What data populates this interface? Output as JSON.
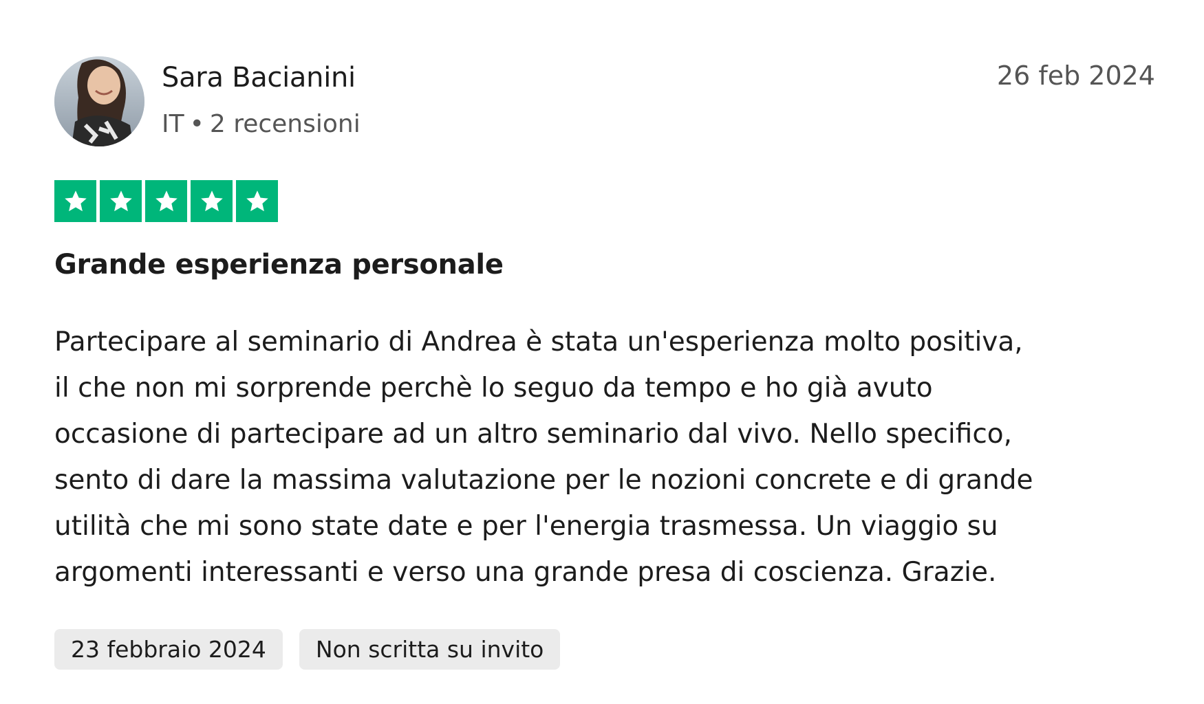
{
  "review": {
    "author": {
      "name": "Sara Bacianini",
      "country": "IT",
      "separator": "•",
      "review_count": "2 recensioni",
      "avatar": "user-photo"
    },
    "date": "26 feb 2024",
    "rating": {
      "value": 5,
      "max": 5,
      "color": "#00b67a",
      "icon": "star-icon"
    },
    "title": "Grande esperienza personale",
    "body_lines": [
      "Partecipare al seminario di Andrea è stata un'esperienza molto positiva,",
      "il che non mi sorprende perchè lo seguo da tempo e ho già avuto",
      "occasione di partecipare ad un altro seminario dal vivo. Nello specifico,",
      "sento di dare la massima valutazione per le nozioni concrete e di grande",
      "utilità che mi sono state date e per l'energia trasmessa. Un viaggio su",
      "argomenti interessanti e verso una grande presa di coscienza. Grazie."
    ],
    "tags": [
      "23 febbraio 2024",
      "Non scritta su invito"
    ]
  }
}
